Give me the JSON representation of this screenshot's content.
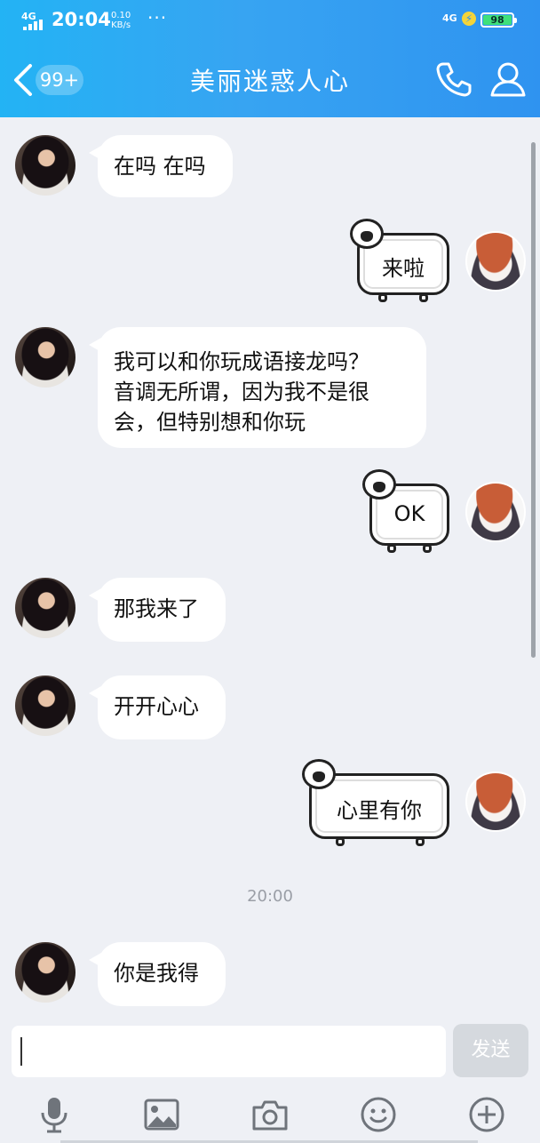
{
  "status_bar": {
    "signal": "4G",
    "time": "20:04",
    "speed_value": "0.10",
    "speed_unit": "KB/s",
    "more": "···",
    "network": "4G",
    "battery": "98"
  },
  "header": {
    "badge": "99+",
    "title": "美丽迷惑人心"
  },
  "messages": [
    {
      "from": "other",
      "text_lines": [
        "在吗 在吗"
      ]
    },
    {
      "from": "me",
      "text": "来啦"
    },
    {
      "from": "other",
      "text_lines": [
        "我可以和你玩成语接龙吗？",
        "音调无所谓，因为我不是很",
        "会，但特别想和你玩"
      ]
    },
    {
      "from": "me",
      "text": "OK"
    },
    {
      "from": "other",
      "text_lines": [
        "那我来了"
      ]
    },
    {
      "from": "other",
      "text_lines": [
        "开开心心"
      ]
    },
    {
      "from": "me",
      "text": "心里有你"
    },
    {
      "from": "other",
      "text_lines": [
        "你是我得"
      ]
    }
  ],
  "timestamp": "20:00",
  "input": {
    "value": "",
    "send_label": "发送"
  },
  "colors": {
    "header_accent": "#2f93f0",
    "background": "#eef0f5"
  },
  "toolbar_icons": [
    "microphone-icon",
    "image-icon",
    "camera-icon",
    "emoji-icon",
    "plus-icon"
  ]
}
